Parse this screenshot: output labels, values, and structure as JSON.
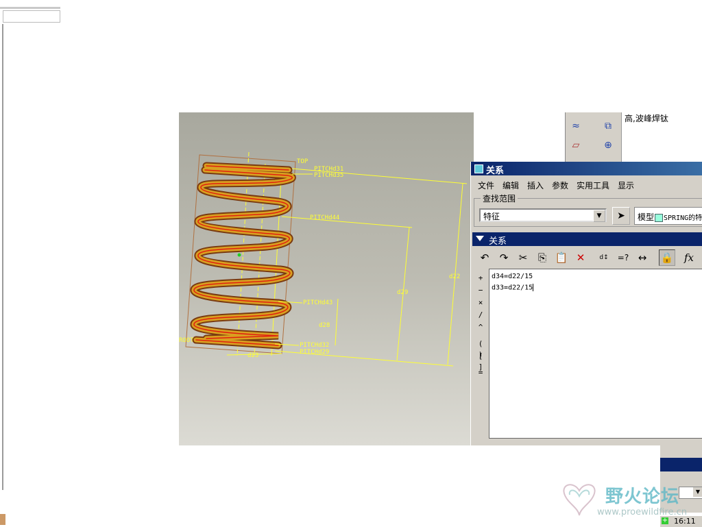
{
  "right_panel": {
    "text": "高,波峰焊钛"
  },
  "viewport": {
    "labels": {
      "top": "TOP",
      "root": "ROOT",
      "pitch_d31": "PITCHd31",
      "pitch_d35": "PITCHd35",
      "pitch_d44": "PITCHd44",
      "pitch_d43": "PITCHd43",
      "pitch_d32": "PITCHd32",
      "pitch_d29": "PITCHd29",
      "d22": "d22",
      "d29": "d29",
      "d28": "d28",
      "d23": "d23"
    }
  },
  "dialog": {
    "title": "关系",
    "menu": [
      "文件",
      "编辑",
      "插入",
      "参数",
      "实用工具",
      "显示"
    ],
    "search_group": "查找范围",
    "search_select": "特征",
    "model_label": "模型",
    "model_name": "SPRING的特",
    "section_title": "关系",
    "side_buttons": [
      "+",
      "−",
      "×",
      "/",
      "^",
      "( )",
      "[ ]",
      "="
    ],
    "relations": [
      "d34=d22/15",
      "d33=d22/15"
    ]
  },
  "taskbar": {
    "time": "16:11"
  },
  "watermark": {
    "title": "野火论坛",
    "url": "www.proewildfire.cn"
  },
  "colors": {
    "titlebar": "#0a246a",
    "spring": "#d9a020",
    "dimension": "#ffff33",
    "viewport_bg": "#bdbcb2"
  }
}
